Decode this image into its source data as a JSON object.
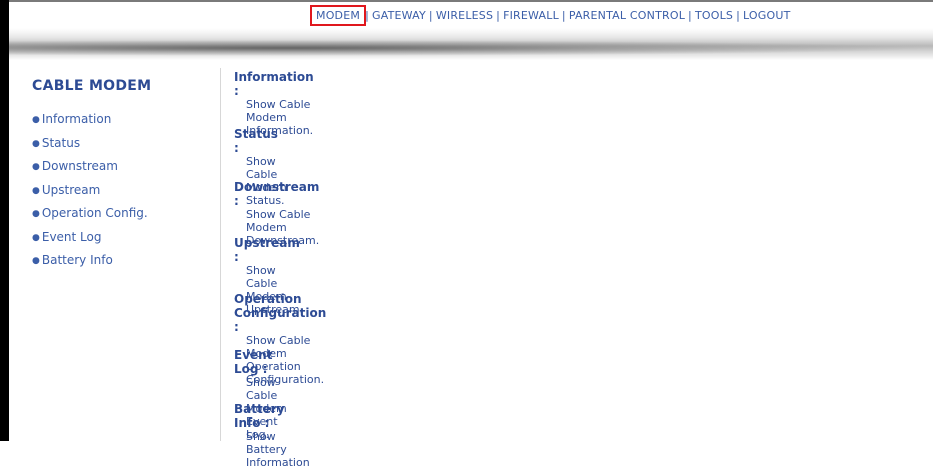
{
  "nav": {
    "items": [
      "MODEM",
      "GATEWAY",
      "WIRELESS",
      "FIREWALL",
      "PARENTAL CONTROL",
      "TOOLS",
      "LOGOUT"
    ],
    "separator": "|",
    "active": "MODEM",
    "highlight_color": "#e0171d"
  },
  "sidebar": {
    "title": "CABLE MODEM",
    "bullet": "●",
    "items": [
      "Information",
      "Status",
      "Downstream",
      "Upstream",
      "Operation Config.",
      "Event Log",
      "Battery Info"
    ]
  },
  "sections": [
    {
      "heading": "Information :",
      "description": "Show Cable Modem Information."
    },
    {
      "heading": "Status :",
      "description": "Show Cable Modem Status."
    },
    {
      "heading": "Downstream :",
      "description": "Show Cable Modem Downstream."
    },
    {
      "heading": "Upstream :",
      "description": "Show Cable Modem Upstream."
    },
    {
      "heading": "Operation Configuration :",
      "description": "Show Cable Modem Operation Configuration."
    },
    {
      "heading": "Event Log :",
      "description": "Show Cable Modem Event Log."
    },
    {
      "heading": "Battery Info :",
      "description": "Show Battery Information"
    }
  ],
  "colors": {
    "link": "#3b5ea8",
    "heading": "#2d4b94"
  }
}
